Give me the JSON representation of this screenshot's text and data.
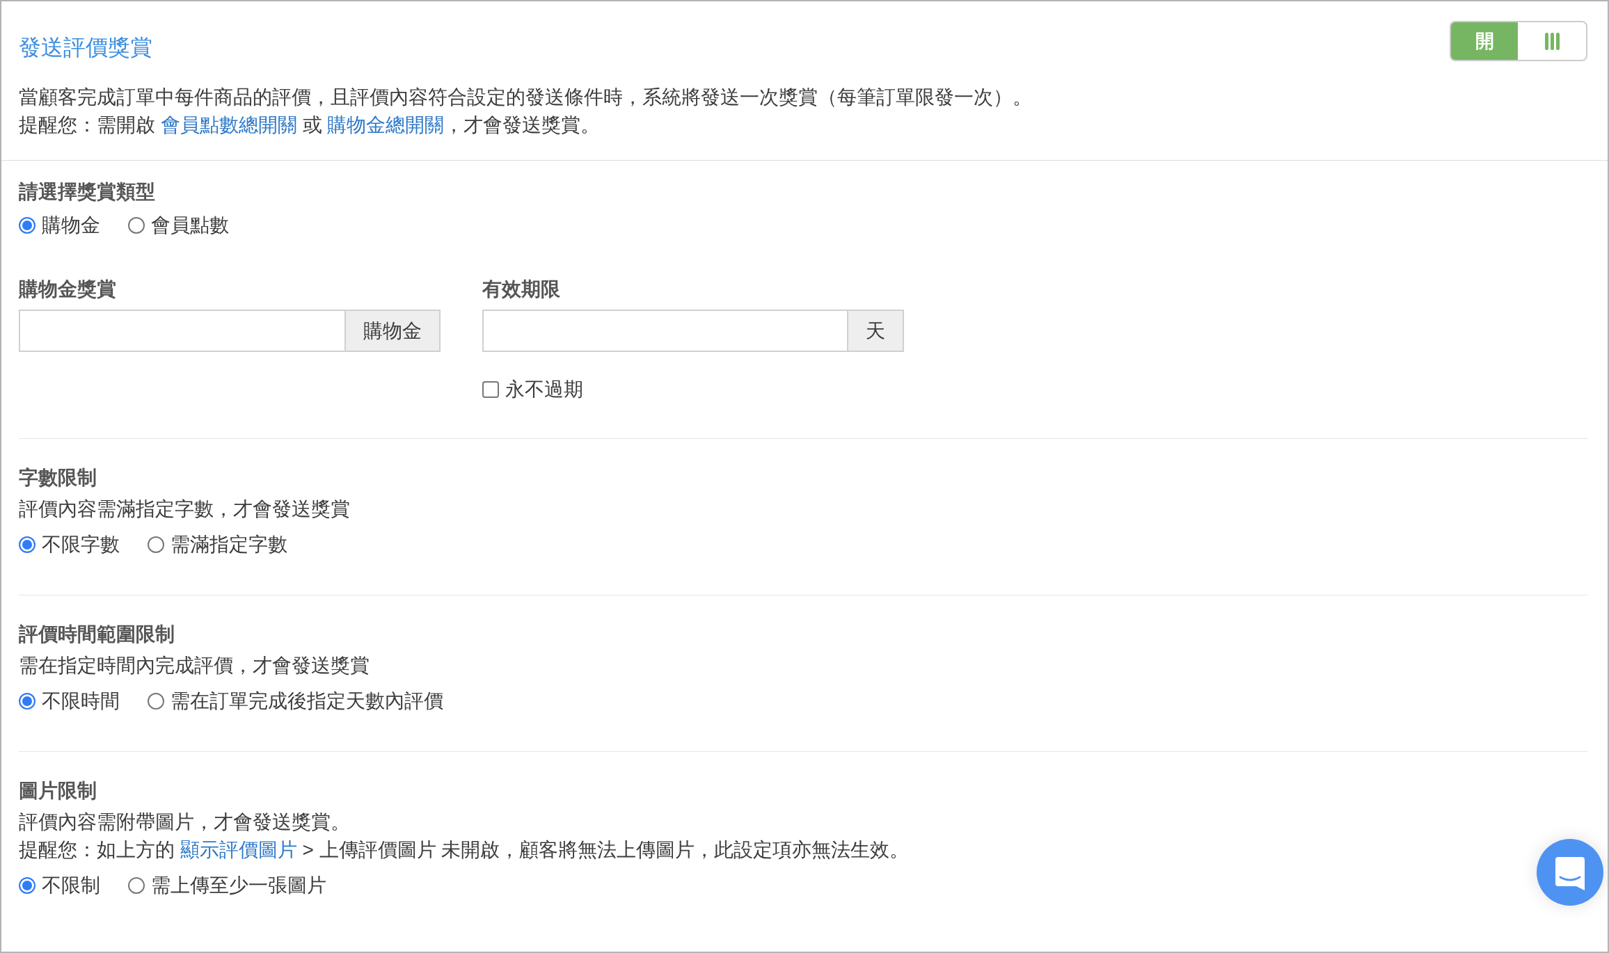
{
  "header": {
    "title": "發送評價獎賞",
    "toggle": {
      "label": "開",
      "on": true
    },
    "lines": [
      [
        {
          "kind": "text",
          "text": "當顧客完成訂單中每件商品的評價，且評價內容符合設定的發送條件時，系統將發送一次獎賞（每筆訂單限發一次）。"
        }
      ],
      [
        {
          "kind": "text",
          "text": "提醒您：需開啟 "
        },
        {
          "kind": "link",
          "text": "會員點數總開關"
        },
        {
          "kind": "text",
          "text": " 或 "
        },
        {
          "kind": "link",
          "text": "購物金總開關"
        },
        {
          "kind": "text",
          "text": "，才會發送獎賞。"
        }
      ]
    ]
  },
  "reward_type": {
    "heading": "請選擇獎賞類型",
    "options": [
      {
        "label": "購物金",
        "selected": true
      },
      {
        "label": "會員點數",
        "selected": false
      }
    ]
  },
  "fields": [
    {
      "label": "購物金獎賞",
      "addon": "購物金"
    },
    {
      "label": "有效期限",
      "addon": "天",
      "option": {
        "label": "永不過期",
        "checked": false
      }
    }
  ],
  "limits": [
    {
      "heading": "字數限制",
      "lines": [
        [
          {
            "kind": "text",
            "text": "評價內容需滿指定字數，才會發送獎賞"
          }
        ]
      ],
      "options": [
        {
          "label": "不限字數",
          "selected": true
        },
        {
          "label": "需滿指定字數",
          "selected": false
        }
      ]
    },
    {
      "heading": "評價時間範圍限制",
      "lines": [
        [
          {
            "kind": "text",
            "text": "需在指定時間內完成評價，才會發送獎賞"
          }
        ]
      ],
      "options": [
        {
          "label": "不限時間",
          "selected": true
        },
        {
          "label": "需在訂單完成後指定天數內評價",
          "selected": false
        }
      ]
    },
    {
      "heading": "圖片限制",
      "lines": [
        [
          {
            "kind": "text",
            "text": "評價內容需附帶圖片，才會發送獎賞。"
          }
        ],
        [
          {
            "kind": "text",
            "text": "提醒您：如上方的 "
          },
          {
            "kind": "link",
            "text": "顯示評價圖片"
          },
          {
            "kind": "text",
            "text": " > 上傳評價圖片 未開啟，顧客將無法上傳圖片，此設定項亦無法生效。"
          }
        ]
      ],
      "options": [
        {
          "label": "不限制",
          "selected": true
        },
        {
          "label": "需上傳至少一張圖片",
          "selected": false
        }
      ]
    }
  ]
}
